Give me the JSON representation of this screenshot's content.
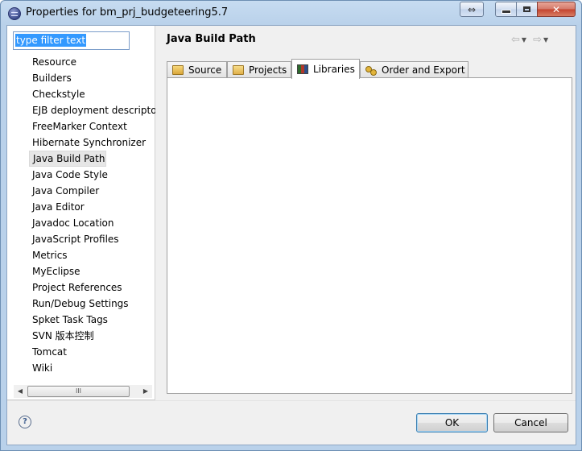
{
  "window": {
    "title": "Properties for bm_prj_budgeteering5.7"
  },
  "filter": {
    "value": "type filter text"
  },
  "tree": {
    "items": [
      "Resource",
      "Builders",
      "Checkstyle",
      "EJB deployment descriptor",
      "FreeMarker Context",
      "Hibernate Synchronizer",
      "Java Build Path",
      "Java Code Style",
      "Java Compiler",
      "Java Editor",
      "Javadoc Location",
      "JavaScript Profiles",
      "Metrics",
      "MyEclipse",
      "Project References",
      "Run/Debug Settings",
      "Spket Task Tags",
      "SVN 版本控制",
      "Tomcat",
      "Wiki"
    ],
    "selected_index": 6
  },
  "page": {
    "title": "Java Build Path"
  },
  "tabs": [
    {
      "label": "Source",
      "icon": "source-folder-icon"
    },
    {
      "label": "Projects",
      "icon": "project-folder-icon"
    },
    {
      "label": "Libraries",
      "icon": "libraries-icon",
      "active": true
    },
    {
      "label": "Order and Export",
      "icon": "order-export-icon"
    }
  ],
  "buttons": {
    "ok": "OK",
    "cancel": "Cancel",
    "help": "?"
  },
  "scrollbar": {
    "thumb_glyph": "III"
  },
  "colors": {
    "selection": "#3399ff",
    "titlebar": "#b9d1ea",
    "close_button": "#c3432d"
  }
}
